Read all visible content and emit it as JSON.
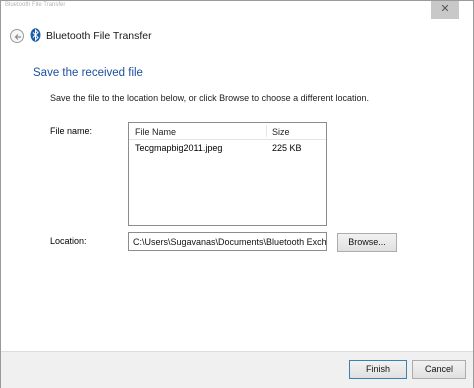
{
  "window": {
    "titlebar_text": "Bluetooth File Transfer",
    "close_glyph": "✕",
    "back_icon": "back-arrow-icon",
    "bluetooth_icon": "bluetooth-icon"
  },
  "wizard": {
    "title": "Bluetooth File Transfer",
    "heading": "Save the received file",
    "instruction": "Save the file to the location below, or click Browse to choose a different location."
  },
  "file_section": {
    "label": "File name:",
    "columns": [
      "File Name",
      "Size"
    ],
    "rows": [
      {
        "name": "Tecgmapbig2011.jpeg",
        "size": "225 KB"
      }
    ]
  },
  "location_section": {
    "label": "Location:",
    "value": "C:\\Users\\Sugavanas\\Documents\\Bluetooth Exchange Folder",
    "browse_label": "Browse..."
  },
  "footer": {
    "finish_label": "Finish",
    "cancel_label": "Cancel"
  },
  "colors": {
    "heading": "#1c4f9c",
    "bluetooth": "#1d5fa6"
  }
}
